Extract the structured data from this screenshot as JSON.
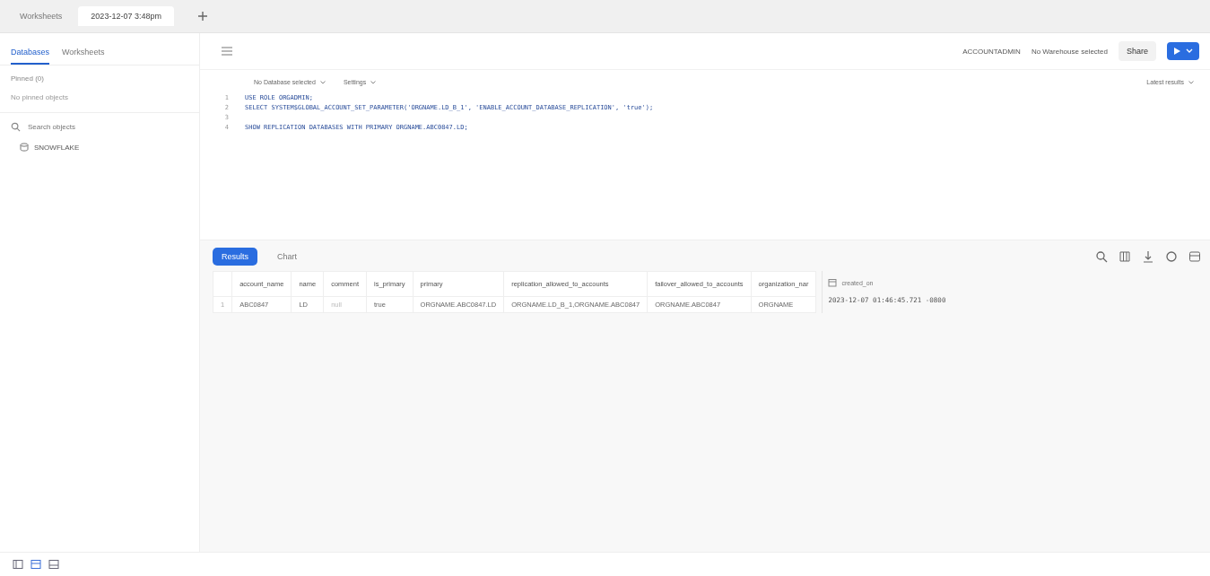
{
  "browser_tabs": [
    {
      "label": "Worksheets",
      "selected": false
    },
    {
      "label": "2023-12-07 3:48pm",
      "selected": true
    }
  ],
  "sidebar": {
    "tabs": [
      {
        "label": "Databases",
        "selected": true
      },
      {
        "label": "Worksheets",
        "selected": false
      }
    ],
    "pinned_label": "Pinned (0)",
    "pinned_empty": "No pinned objects",
    "search": {
      "placeholder": "Search objects"
    },
    "items": [
      {
        "label": "SNOWFLAKE"
      }
    ]
  },
  "toolbar": {
    "role": "ACCOUNTADMIN",
    "warehouse": "No Warehouse selected",
    "share": "Share"
  },
  "editor": {
    "database": "No Database selected",
    "settings": "Settings",
    "results_mode": "Latest results",
    "lines": [
      {
        "number": "1",
        "text": "USE ROLE ORGADMIN;"
      },
      {
        "number": "2",
        "text": "SELECT SYSTEM$GLOBAL_ACCOUNT_SET_PARAMETER('ORGNAME.LD_B_1', 'ENABLE_ACCOUNT_DATABASE_REPLICATION', 'true');"
      },
      {
        "number": "3"
      },
      {
        "number": "4",
        "text": "SHOW REPLICATION DATABASES WITH PRIMARY ORGNAME.ABC0847.LD;"
      }
    ]
  },
  "results": {
    "tabs": [
      {
        "label": "Results",
        "selected": true
      },
      {
        "label": "Chart",
        "selected": false
      }
    ],
    "columns": [
      "account_name",
      "name",
      "comment",
      "is_primary",
      "primary",
      "replication_allowed_to_accounts",
      "failover_allowed_to_accounts",
      "organization_nar"
    ],
    "rows": [
      {
        "number": "1",
        "cells": [
          "ABC0847",
          "LD",
          "null",
          "true",
          "ORGNAME.ABC0847.LD",
          "ORGNAME.LD_B_1,ORGNAME.ABC0847",
          "ORGNAME.ABC0847",
          "ORGNAME"
        ]
      }
    ],
    "detail": {
      "label": "created_on",
      "value": "2023-12-07 01:46:45.721 -0800"
    }
  }
}
